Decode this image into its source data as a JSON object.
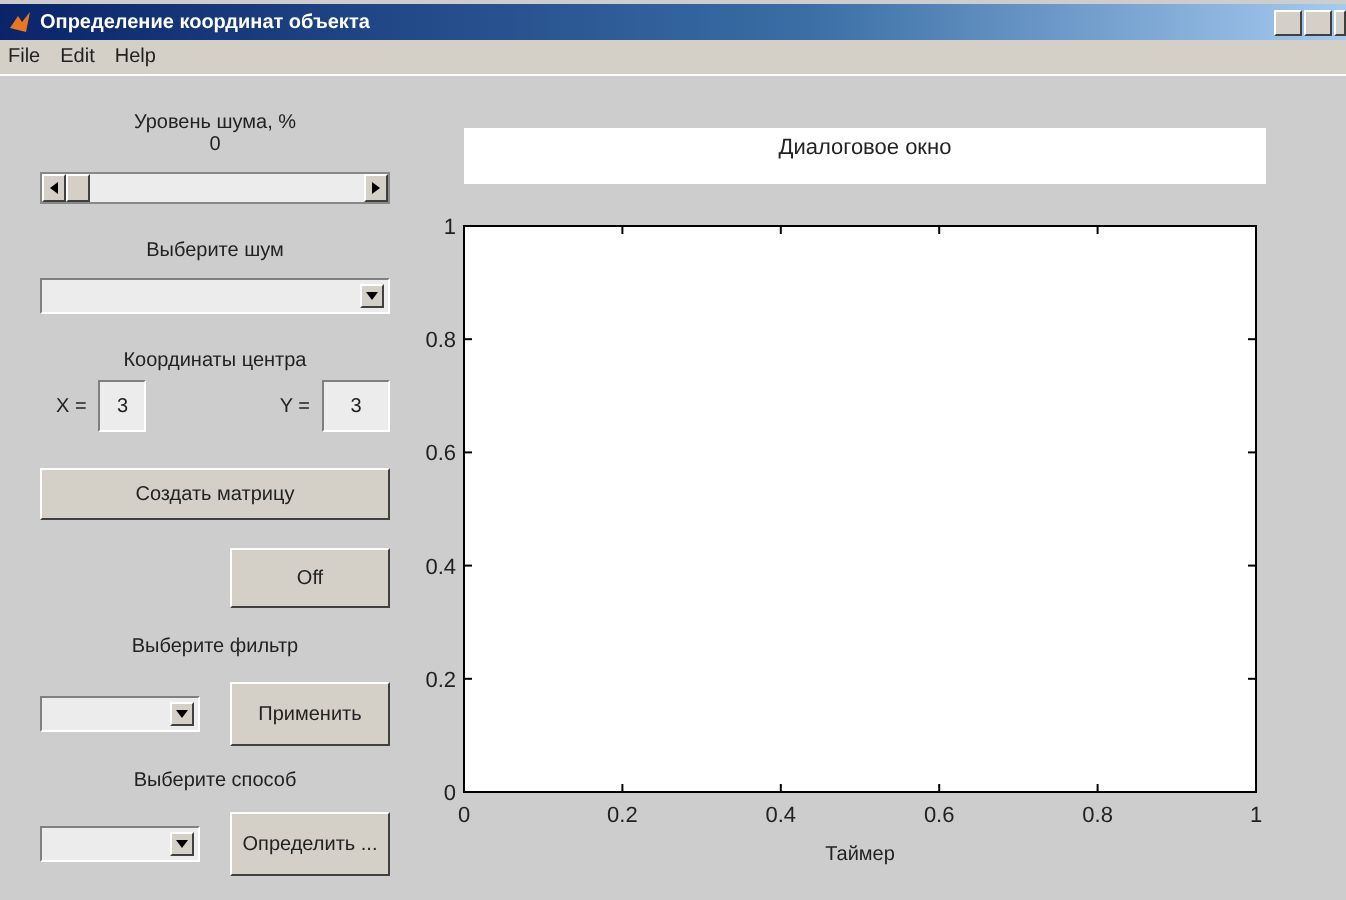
{
  "window": {
    "title": "Определение координат объекта"
  },
  "menu": [
    "File",
    "Edit",
    "Help"
  ],
  "controls": {
    "noise_label": "Уровень шума, %",
    "noise_value": "0",
    "noise_select_label": "Выберите шум",
    "center_label": "Координаты центра",
    "x_label": "X =",
    "x_value": "3",
    "y_label": "Y =",
    "y_value": "3",
    "create_button": "Создать матрицу",
    "toggle_button": "Off",
    "filter_label": "Выберите фильтр",
    "apply_button": "Применить",
    "method_label": "Выберите способ",
    "detect_button": "Определить ..."
  },
  "dialog": {
    "text": "Диалоговое окно"
  },
  "plot": {
    "chart_data": {
      "type": "line",
      "xlabel": "Таймер",
      "xlim": [
        0,
        1
      ],
      "ylim": [
        0,
        1
      ],
      "xticks": [
        0,
        0.2,
        0.4,
        0.6,
        0.8,
        1
      ],
      "yticks": [
        0,
        0.2,
        0.4,
        0.6,
        0.8,
        1
      ]
    }
  }
}
